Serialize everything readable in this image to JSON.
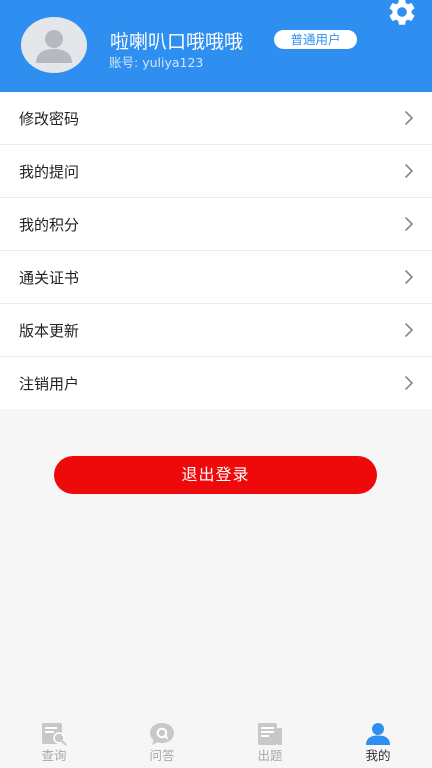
{
  "colors": {
    "header_bg": "#2f8ff0",
    "logout_bg": "#ee0a0a",
    "tab_active": "#2f8ff0",
    "tab_inactive": "#c8c8c8"
  },
  "profile": {
    "username": "啦喇叭口哦哦哦",
    "account_label": "账号:",
    "account_value": "yuliya123",
    "role_badge": "普通用户",
    "avatar_icon": "avatar-placeholder-icon",
    "settings_icon": "gear-icon"
  },
  "menu": {
    "items": [
      {
        "label": "修改密码",
        "icon": "chevron-right-icon"
      },
      {
        "label": "我的提问",
        "icon": "chevron-right-icon"
      },
      {
        "label": "我的积分",
        "icon": "chevron-right-icon"
      },
      {
        "label": "通关证书",
        "icon": "chevron-right-icon"
      },
      {
        "label": "版本更新",
        "icon": "chevron-right-icon"
      },
      {
        "label": "注销用户",
        "icon": "chevron-right-icon"
      }
    ]
  },
  "logout_label": "退出登录",
  "tabs": [
    {
      "label": "查询",
      "icon": "search-document-icon",
      "active": false
    },
    {
      "label": "问答",
      "icon": "chat-bubble-icon",
      "active": false
    },
    {
      "label": "出题",
      "icon": "newspaper-icon",
      "active": false
    },
    {
      "label": "我的",
      "icon": "person-icon",
      "active": true
    }
  ]
}
